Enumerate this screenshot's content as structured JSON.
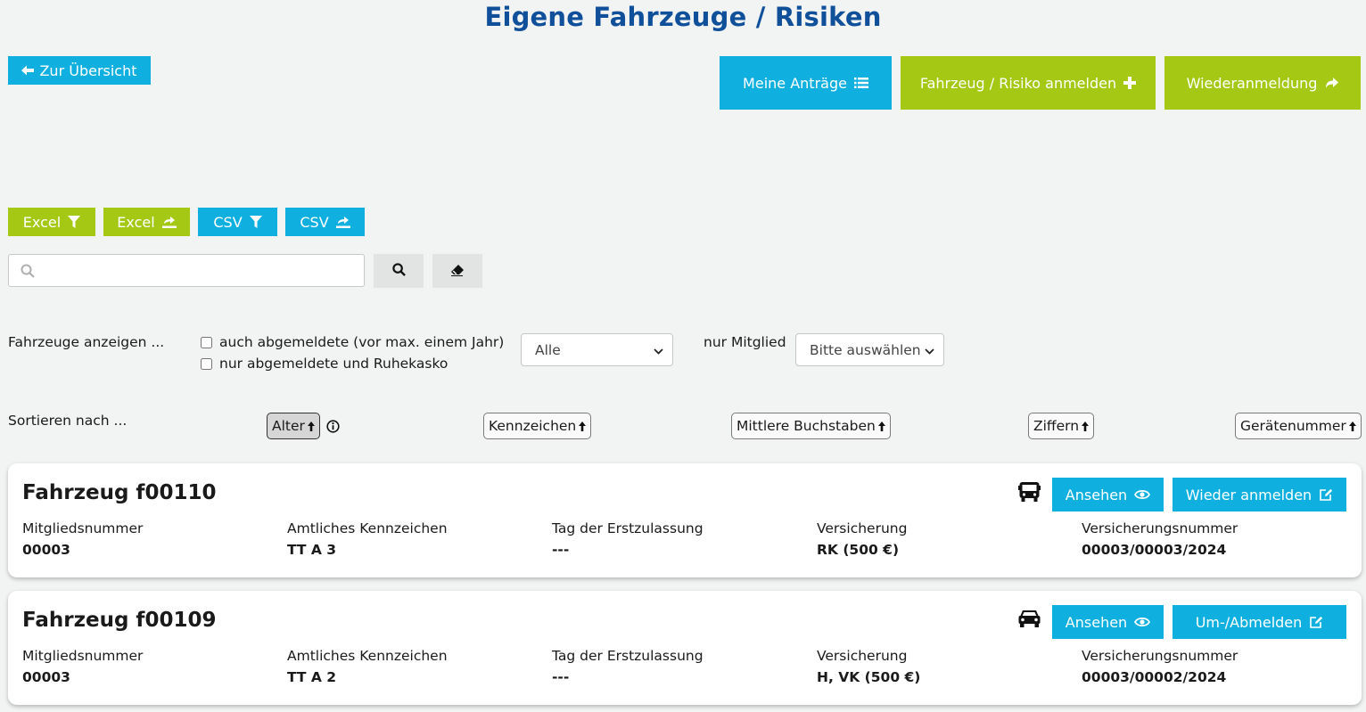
{
  "page": {
    "title": "Eigene Fahrzeuge / Risiken"
  },
  "nav": {
    "back_label": "Zur Übersicht"
  },
  "actions": {
    "my_requests": "Meine Anträge",
    "register_vehicle": "Fahrzeug / Risiko anmelden",
    "reregister": "Wiederanmeldung"
  },
  "exports": [
    {
      "label": "Excel",
      "icon": "filter-icon",
      "color": "#a5c814"
    },
    {
      "label": "Excel",
      "icon": "export-icon",
      "color": "#a5c814"
    },
    {
      "label": "CSV",
      "icon": "filter-icon",
      "color": "#0fb0e0"
    },
    {
      "label": "CSV",
      "icon": "export-icon",
      "color": "#0fb0e0"
    }
  ],
  "search": {
    "placeholder": "",
    "value": ""
  },
  "filters": {
    "show_label": "Fahrzeuge anzeigen ...",
    "checkbox_deregistered": "auch abgemeldete (vor max. einem Jahr)",
    "checkbox_only_deregistered": "nur abgemeldete und Ruhekasko",
    "status_select": "Alle",
    "member_label": "nur Mitglied",
    "member_select": "Bitte auswählen"
  },
  "sort": {
    "label": "Sortieren nach ...",
    "options": [
      "Alter",
      "Kennzeichen",
      "Mittlere Buchstaben",
      "Ziffern",
      "Gerätenummer"
    ],
    "active": "Alter"
  },
  "vehicles": [
    {
      "title": "Fahrzeug f00110",
      "vehicle_icon": "bus-icon",
      "view_label": "Ansehen",
      "action_label": "Wieder anmelden",
      "fields": [
        {
          "label": "Mitgliedsnummer",
          "value": "00003"
        },
        {
          "label": "Amtliches Kennzeichen",
          "value": "TT A 3"
        },
        {
          "label": "Tag der Erstzulassung",
          "value": "---"
        },
        {
          "label": "Versicherung",
          "value": "RK (500 €)"
        },
        {
          "label": "Versicherungsnummer",
          "value": "00003/00003/2024"
        }
      ]
    },
    {
      "title": "Fahrzeug f00109",
      "vehicle_icon": "car-icon",
      "view_label": "Ansehen",
      "action_label": "Um-/Abmelden",
      "fields": [
        {
          "label": "Mitgliedsnummer",
          "value": "00003"
        },
        {
          "label": "Amtliches Kennzeichen",
          "value": "TT A 2"
        },
        {
          "label": "Tag der Erstzulassung",
          "value": "---"
        },
        {
          "label": "Versicherung",
          "value": "H, VK (500 €)"
        },
        {
          "label": "Versicherungsnummer",
          "value": "00003/00002/2024"
        }
      ]
    }
  ],
  "colors": {
    "primary_blue": "#0fb0e0",
    "primary_green": "#a5c814",
    "title_blue": "#10509a"
  }
}
